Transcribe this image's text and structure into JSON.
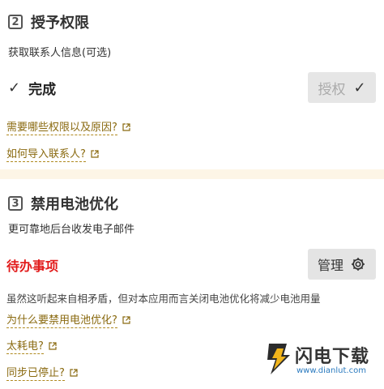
{
  "section_grant": {
    "step_number": "2",
    "title": "授予权限",
    "description": "获取联系人信息(可选)",
    "status_label": "完成",
    "grant_button_label": "授权",
    "links": [
      "需要哪些权限以及原因?",
      "如何导入联系人?"
    ]
  },
  "section_battery": {
    "step_number": "3",
    "title": "禁用电池优化",
    "description": "更可靠地后台收发电子邮件",
    "todo_label": "待办事项",
    "manage_button_label": "管理",
    "note": "虽然这听起来自相矛盾，但对本应用而言关闭电池优化将减少电池用量",
    "links": [
      "为什么要禁用电池优化?",
      "太耗电?",
      "同步已停止?"
    ]
  },
  "watermark": {
    "name": "闪电下载",
    "url": "www.dianlut.com"
  },
  "colors": {
    "link": "#8a6a10",
    "todo": "#e21b1b",
    "background": "#fdf5e6"
  }
}
